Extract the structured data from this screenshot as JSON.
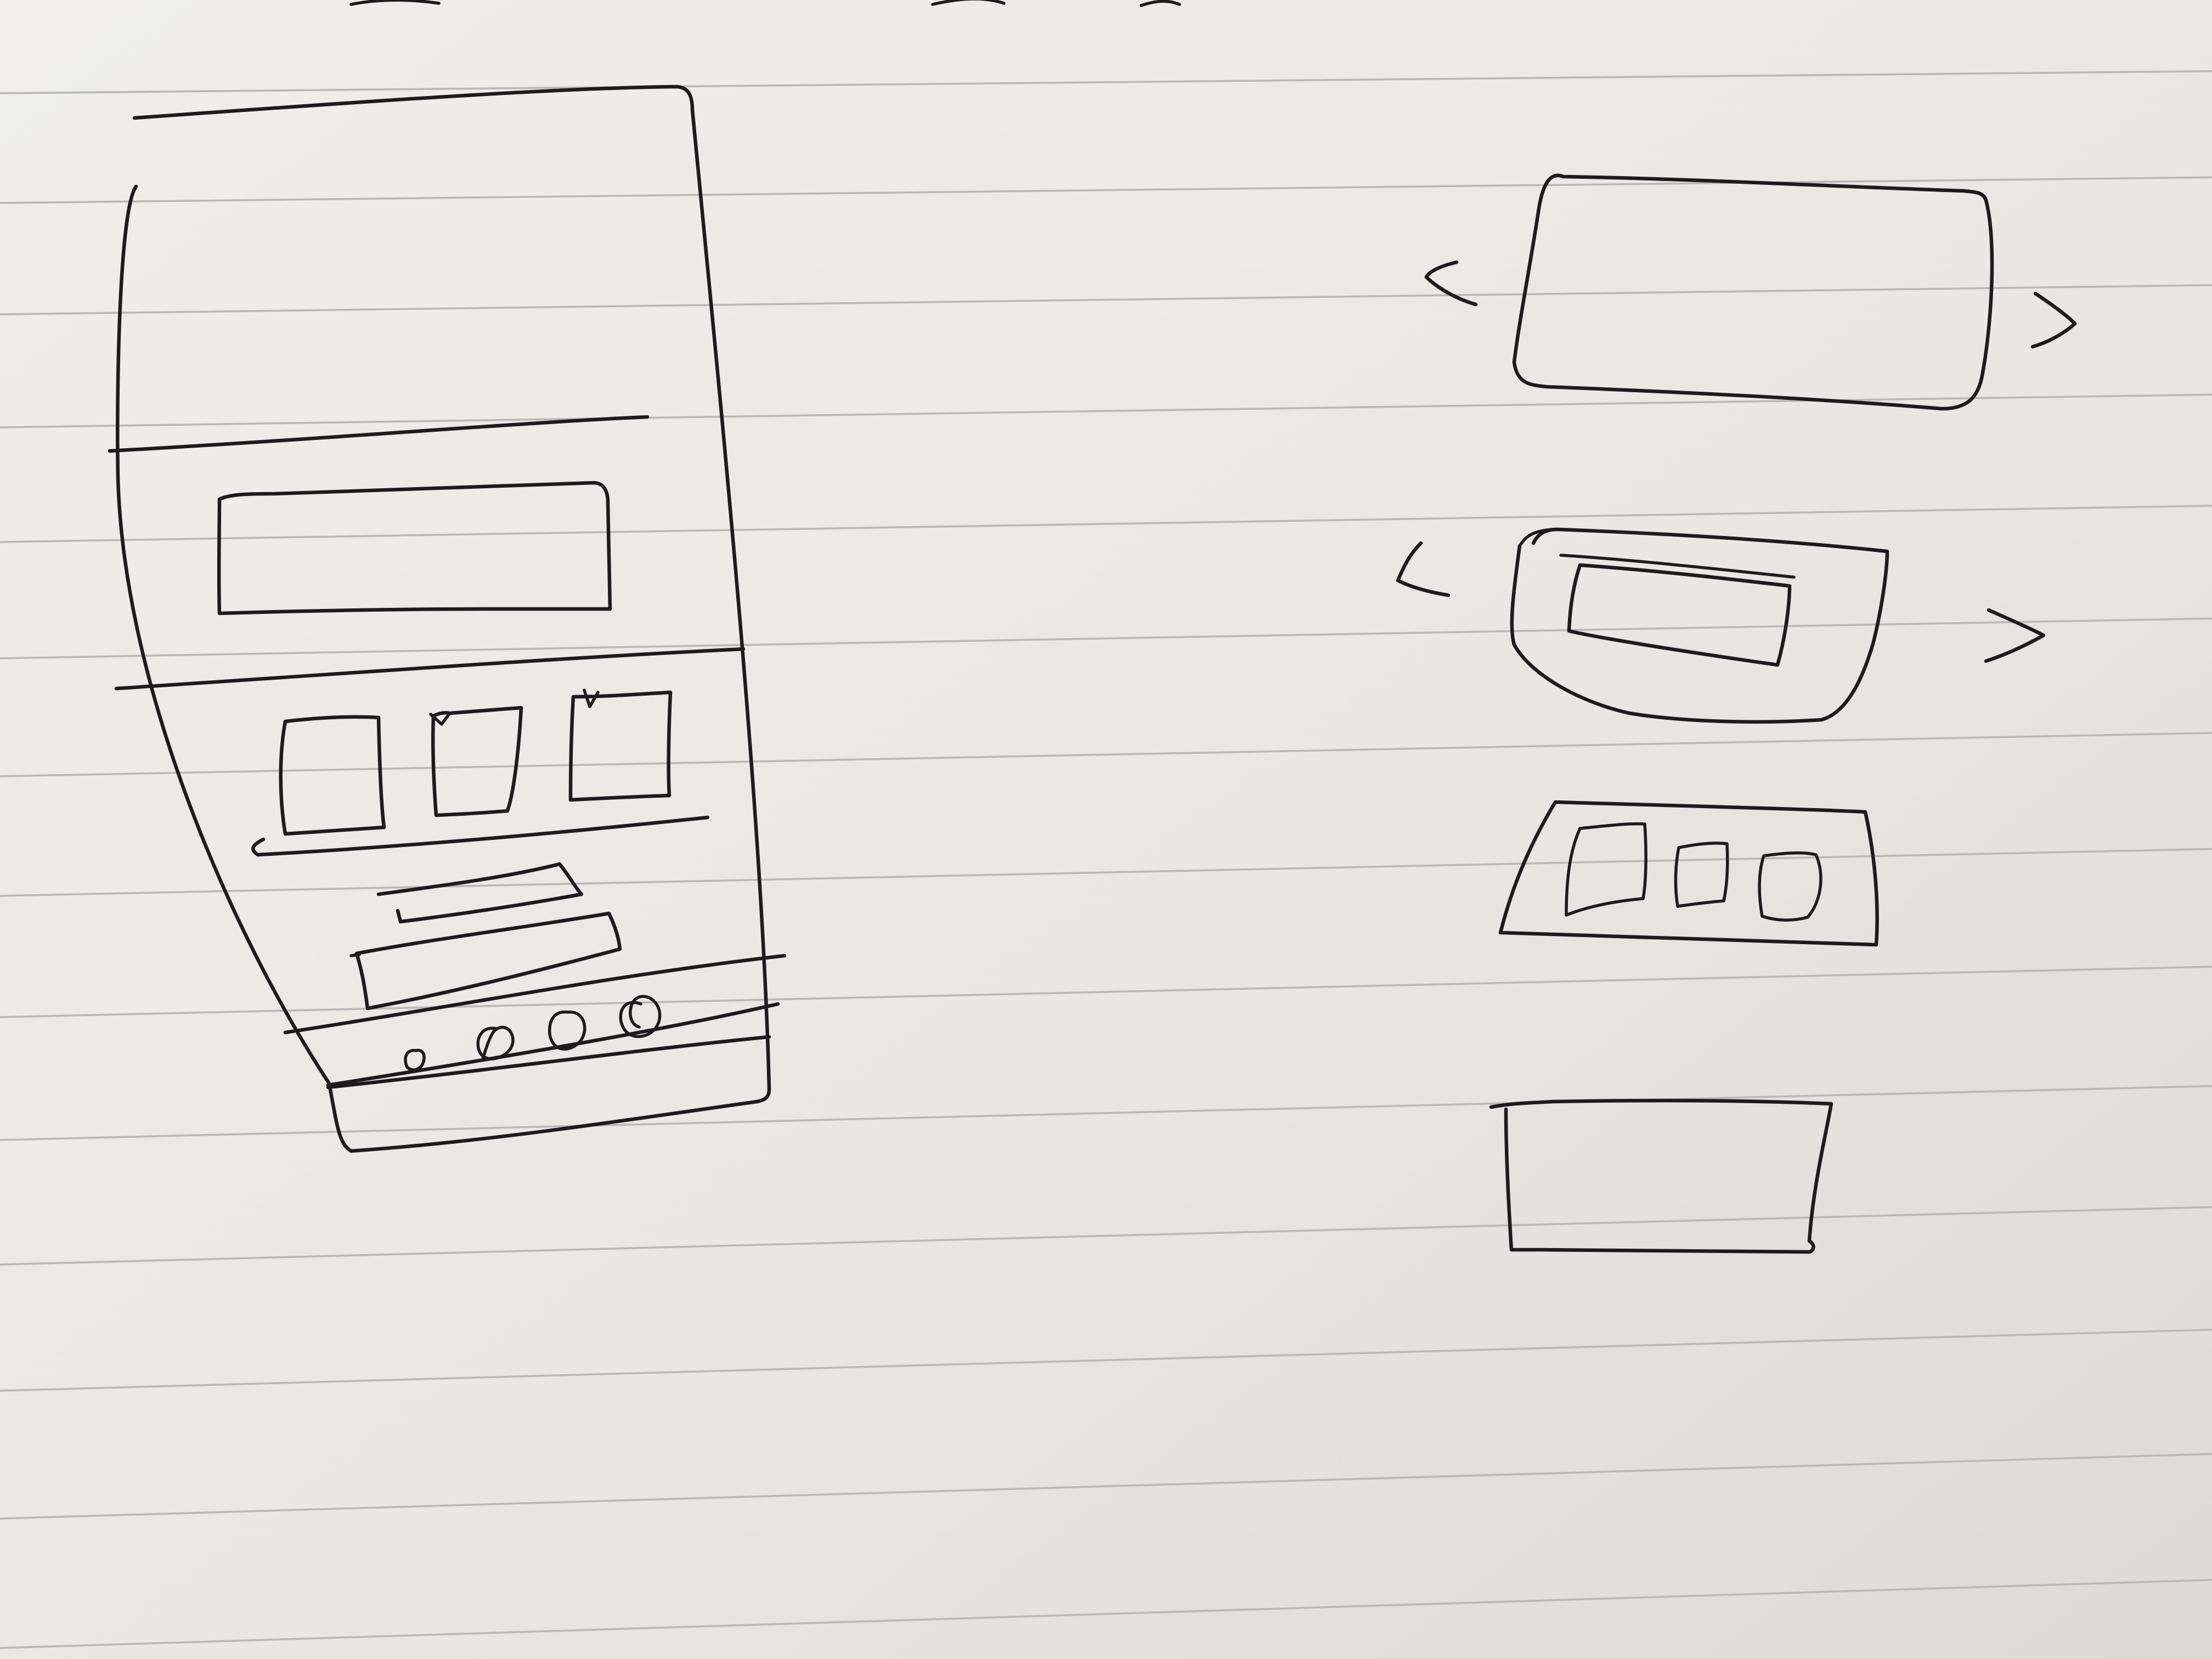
{
  "page": {
    "paper_color": "#eae8e5",
    "ruled_line_color": "#b9b7b6",
    "ink_color": "#1d1b1e"
  },
  "sketches": {
    "phone_wireframe": {
      "sections": [
        "header",
        "banner",
        "thumbnail-row",
        "content-bars",
        "pagination-dots",
        "footer"
      ],
      "thumbnail_count": 3,
      "content_bar_count": 2,
      "pagination_dot_count": 4
    },
    "component_studies": [
      {
        "name": "image-carousel",
        "has_prev_arrow": true,
        "has_next_arrow": true
      },
      {
        "name": "nested-card-carousel",
        "has_prev_arrow": true,
        "has_next_arrow": true
      },
      {
        "name": "thumbnail-strip",
        "thumbnail_count": 3
      },
      {
        "name": "plain-panel"
      }
    ]
  }
}
